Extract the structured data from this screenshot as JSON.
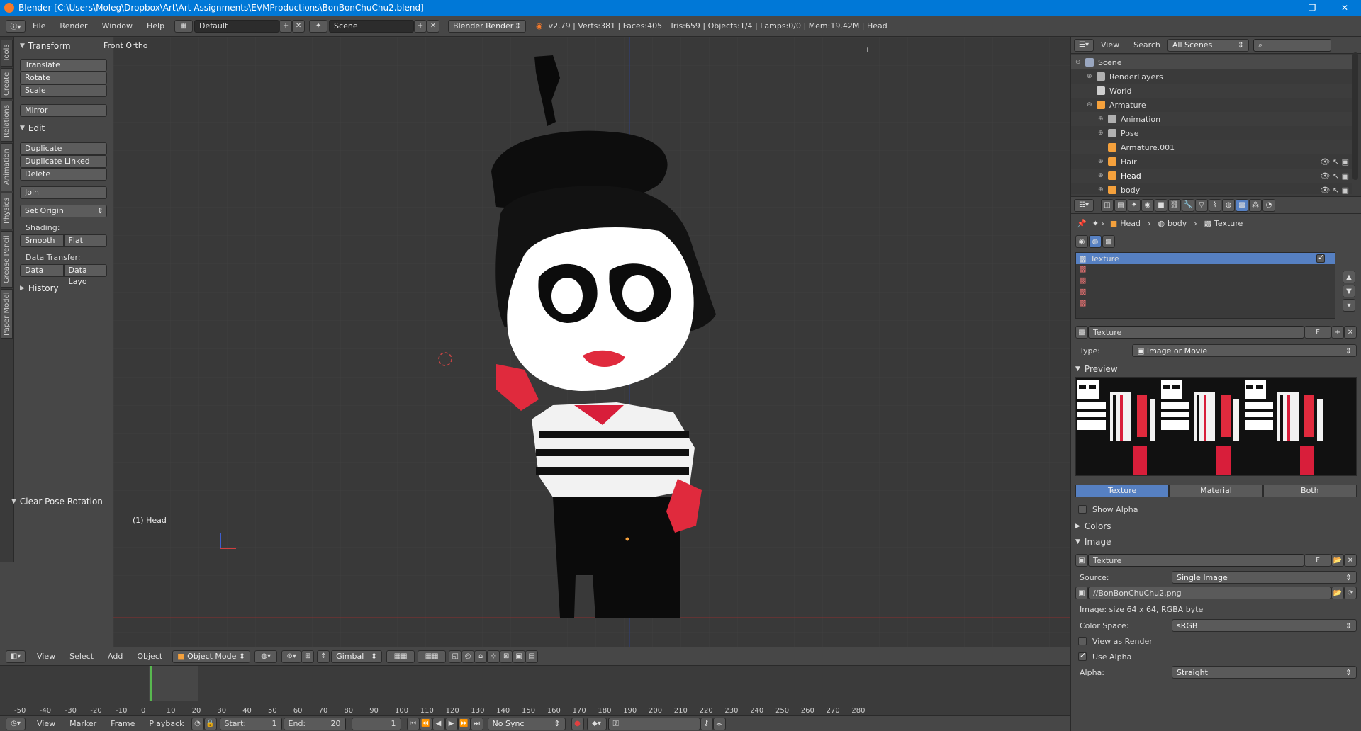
{
  "window": {
    "title": "Blender [C:\\Users\\Moleg\\Dropbox\\Art\\Art Assignments\\EVMProductions\\BonBonChuChu2.blend]"
  },
  "info": {
    "menus": [
      "File",
      "Render",
      "Window",
      "Help"
    ],
    "layout": "Default",
    "scene": "Scene",
    "engine": "Blender Render",
    "stats": "v2.79 | Verts:381 | Faces:405 | Tris:659 | Objects:1/4 | Lamps:0/0 | Mem:19.42M | Head"
  },
  "tabs": [
    "Tools",
    "Create",
    "Relations",
    "Animation",
    "Physics",
    "Grease Pencil",
    "Paper Model"
  ],
  "toolshelf": {
    "transform_header": "Transform",
    "translate": "Translate",
    "rotate": "Rotate",
    "scale": "Scale",
    "mirror": "Mirror",
    "edit_header": "Edit",
    "duplicate": "Duplicate",
    "duplicate_linked": "Duplicate Linked",
    "delete": "Delete",
    "join": "Join",
    "set_origin": "Set Origin",
    "shading_label": "Shading:",
    "smooth": "Smooth",
    "flat": "Flat",
    "data_transfer_label": "Data Transfer:",
    "data": "Data",
    "data_layo": "Data Layo",
    "history_header": "History",
    "operator_header": "Clear Pose Rotation"
  },
  "viewport": {
    "view_name": "Front Ortho",
    "object_label": "(1) Head"
  },
  "viewheader": {
    "menus": [
      "View",
      "Select",
      "Add",
      "Object"
    ],
    "mode": "Object Mode",
    "orientation": "Gimbal"
  },
  "timeline": {
    "ruler": [
      "-50",
      "-40",
      "-30",
      "-20",
      "-10",
      "0",
      "10",
      "20",
      "30",
      "40",
      "50",
      "60",
      "70",
      "80",
      "90",
      "100",
      "110",
      "120",
      "130",
      "140",
      "150",
      "160",
      "170",
      "180",
      "190",
      "200",
      "210",
      "220",
      "230",
      "240",
      "250",
      "260",
      "270",
      "280"
    ],
    "menus": [
      "View",
      "Marker",
      "Frame",
      "Playback"
    ],
    "start_label": "Start:",
    "start": "1",
    "end_label": "End:",
    "end": "20",
    "current": "1",
    "sync": "No Sync"
  },
  "outliner": {
    "view": "View",
    "search": "Search",
    "filter": "All Scenes",
    "rows": [
      {
        "label": "Scene",
        "indent": 0
      },
      {
        "label": "RenderLayers",
        "indent": 1
      },
      {
        "label": "World",
        "indent": 1
      },
      {
        "label": "Armature",
        "indent": 1
      },
      {
        "label": "Animation",
        "indent": 2
      },
      {
        "label": "Pose",
        "indent": 2
      },
      {
        "label": "Armature.001",
        "indent": 2
      },
      {
        "label": "Hair",
        "indent": 2
      },
      {
        "label": "Head",
        "indent": 2
      },
      {
        "label": "body",
        "indent": 2
      }
    ]
  },
  "props": {
    "breadcrumb": [
      "Head",
      "body",
      "Texture"
    ],
    "slot_name": "Texture",
    "texture_name": "Texture",
    "fake_user": "F",
    "type_label": "Type:",
    "type_value": "Image or Movie",
    "preview_header": "Preview",
    "preview_tabs": [
      "Texture",
      "Material",
      "Both"
    ],
    "show_alpha": "Show Alpha",
    "colors_header": "Colors",
    "image_header": "Image",
    "image_name": "Texture",
    "source_label": "Source:",
    "source_value": "Single Image",
    "path": "//BonBonChuChu2.png",
    "image_info": "Image: size 64 x 64, RGBA byte",
    "colorspace_label": "Color Space:",
    "colorspace_value": "sRGB",
    "view_as_render": "View as Render",
    "use_alpha": "Use Alpha",
    "alpha_label": "Alpha:",
    "alpha_value": "Straight"
  }
}
